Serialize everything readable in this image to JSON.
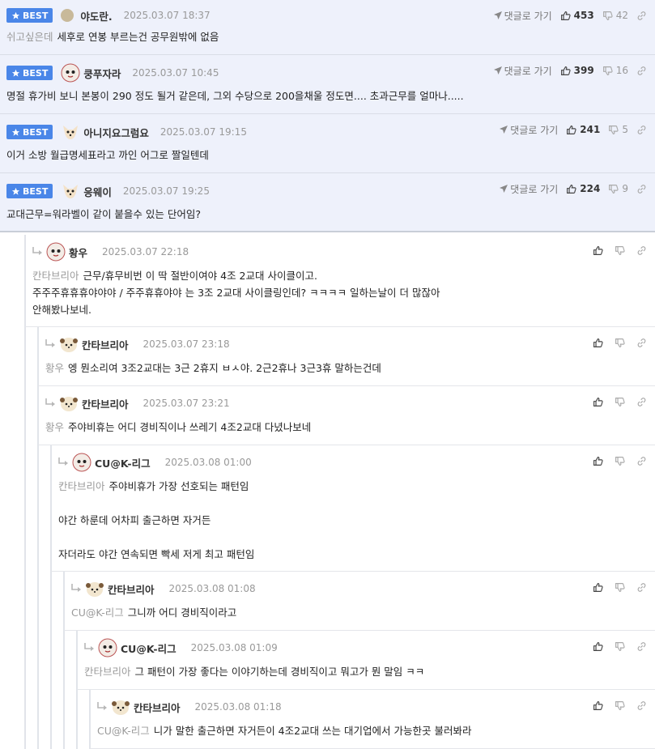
{
  "colors": {
    "best_bg": "#eef1fb",
    "badge": "#4a86e8",
    "border": "#d9dde6"
  },
  "labels": {
    "best": "BEST",
    "goto_reply": "댓글로 가기"
  },
  "best_comments": [
    {
      "nick": "야도란.",
      "date": "2025.03.07 18:37",
      "quote": "쉬고싶은데",
      "text": "세후로 연봉 부르는건 공무원밖에 없음",
      "likes": "453",
      "dislikes": "42"
    },
    {
      "nick": "쿵푸자라",
      "date": "2025.03.07 10:45",
      "quote": "",
      "text": "명절 휴가비 보니 본봉이 290 정도 될거 같은데, 그외 수당으로 200을채울 정도면.... 초과근무를 얼마나.....",
      "likes": "399",
      "dislikes": "16"
    },
    {
      "nick": "아니지요그럼요",
      "date": "2025.03.07 19:15",
      "quote": "",
      "text": "이거 소방 월급명세표라고 까인 어그로 짤일텐데",
      "likes": "241",
      "dislikes": "5"
    },
    {
      "nick": "응웨이",
      "date": "2025.03.07 19:25",
      "quote": "",
      "text": "교대근무=워라벨이 같이 붙을수 있는 단어임?",
      "likes": "224",
      "dislikes": "9"
    }
  ],
  "replies": [
    {
      "nick": "황우",
      "date": "2025.03.07 22:18",
      "quote": "칸타브리아",
      "lines": [
        "근무/휴무비번 이 딱 절반이여야 4조 2교대 사이클이고.",
        "주주주휴휴휴야야야 / 주주휴휴야야 는 3조 2교대 사이클링인데? ㅋㅋㅋㅋ 일하는날이 더 많잖아",
        "안해봤나보네."
      ]
    },
    {
      "nick": "칸타브리아",
      "date": "2025.03.07 23:18",
      "quote": "황우",
      "lines": [
        "엥 뭔소리여 3조2교대는 3근 2휴지 ㅂㅅ야. 2근2휴나 3근3휴 말하는건데"
      ]
    },
    {
      "nick": "칸타브리아",
      "date": "2025.03.07 23:21",
      "quote": "황우",
      "lines": [
        "주야비휴는 어디 경비직이나 쓰레기 4조2교대 다녔나보네"
      ]
    },
    {
      "nick": "CU@K-리그",
      "date": "2025.03.08 01:00",
      "quote": "칸타브리아",
      "lines": [
        "주야비휴가 가장 선호되는 패턴임",
        "",
        "야간 하룬데 어차피 출근하면 자거든",
        "",
        "자더라도 야간 연속되면 빡세 저게 최고 패턴임"
      ]
    },
    {
      "nick": "칸타브리아",
      "date": "2025.03.08 01:08",
      "quote": "CU@K-리그",
      "lines": [
        "그니까 어디 경비직이라고"
      ]
    },
    {
      "nick": "CU@K-리그",
      "date": "2025.03.08 01:09",
      "quote": "칸타브리아",
      "lines": [
        "그 패턴이 가장 좋다는 이야기하는데 경비직이고 뭐고가 뭔 말임 ㅋㅋ"
      ]
    },
    {
      "nick": "칸타브리아",
      "date": "2025.03.08 01:18",
      "quote": "CU@K-리그",
      "lines": [
        "니가 말한 출근하면 자거든이 4조2교대 쓰는 대기업에서 가능한곳 불러봐라"
      ]
    }
  ]
}
